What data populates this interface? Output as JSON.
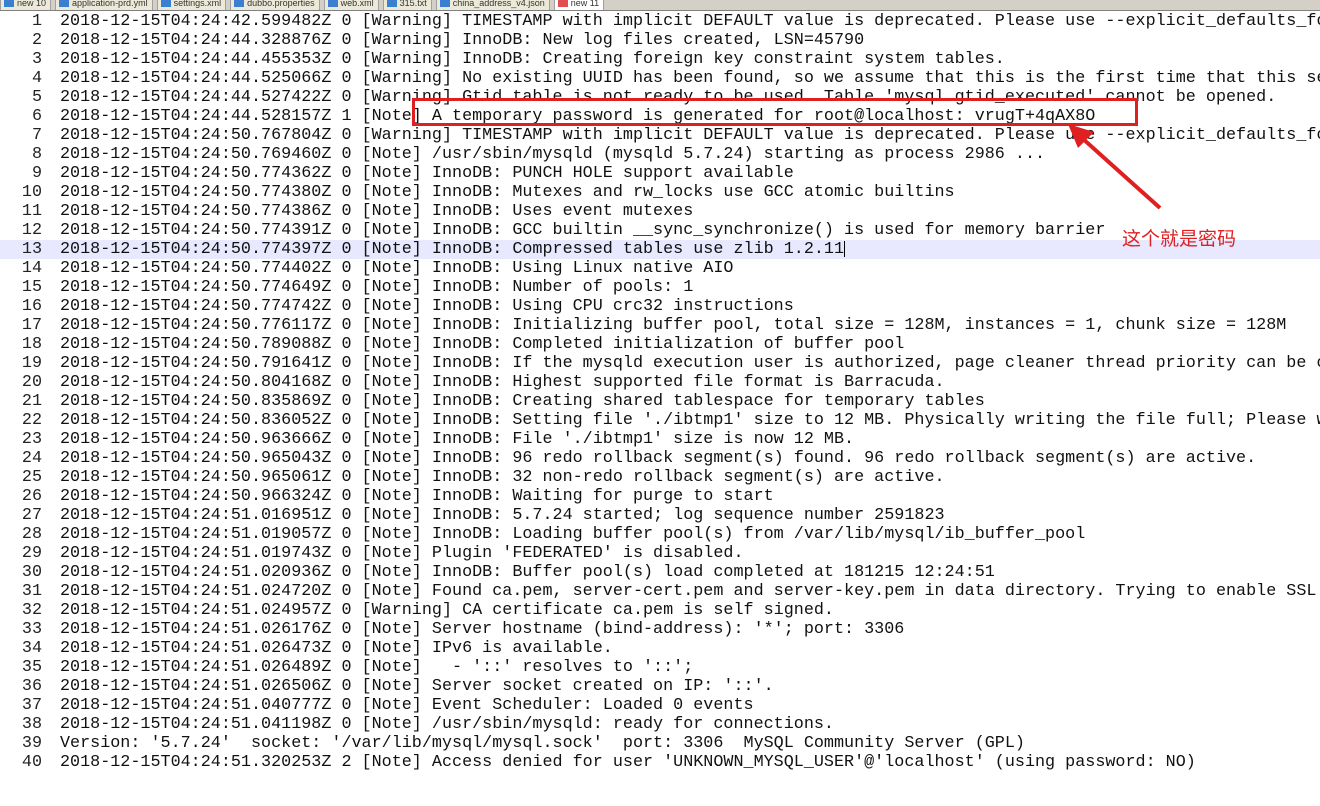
{
  "tabs": [
    {
      "label": "new 10"
    },
    {
      "label": "application-prd.yml"
    },
    {
      "label": "settings.xml"
    },
    {
      "label": "dubbo.properties"
    },
    {
      "label": "web.xml"
    },
    {
      "label": "315.txt"
    },
    {
      "label": "china_address_v4.json"
    },
    {
      "label": "new 11",
      "active": true
    }
  ],
  "editor": {
    "current_line": 13,
    "lines": [
      "2018-12-15T04:24:42.599482Z 0 [Warning] TIMESTAMP with implicit DEFAULT value is deprecated. Please use --explicit_defaults_fo",
      "2018-12-15T04:24:44.328876Z 0 [Warning] InnoDB: New log files created, LSN=45790",
      "2018-12-15T04:24:44.455353Z 0 [Warning] InnoDB: Creating foreign key constraint system tables.",
      "2018-12-15T04:24:44.525066Z 0 [Warning] No existing UUID has been found, so we assume that this is the first time that this se",
      "2018-12-15T04:24:44.527422Z 0 [Warning] Gtid table is not ready to be used. Table 'mysql.gtid_executed' cannot be opened.",
      "2018-12-15T04:24:44.528157Z 1 [Note] A temporary password is generated for root@localhost: vrugT+4qAX8O",
      "2018-12-15T04:24:50.767804Z 0 [Warning] TIMESTAMP with implicit DEFAULT value is deprecated. Please use --explicit_defaults_fo",
      "2018-12-15T04:24:50.769460Z 0 [Note] /usr/sbin/mysqld (mysqld 5.7.24) starting as process 2986 ...",
      "2018-12-15T04:24:50.774362Z 0 [Note] InnoDB: PUNCH HOLE support available",
      "2018-12-15T04:24:50.774380Z 0 [Note] InnoDB: Mutexes and rw_locks use GCC atomic builtins",
      "2018-12-15T04:24:50.774386Z 0 [Note] InnoDB: Uses event mutexes",
      "2018-12-15T04:24:50.774391Z 0 [Note] InnoDB: GCC builtin __sync_synchronize() is used for memory barrier",
      "2018-12-15T04:24:50.774397Z 0 [Note] InnoDB: Compressed tables use zlib 1.2.11",
      "2018-12-15T04:24:50.774402Z 0 [Note] InnoDB: Using Linux native AIO",
      "2018-12-15T04:24:50.774649Z 0 [Note] InnoDB: Number of pools: 1",
      "2018-12-15T04:24:50.774742Z 0 [Note] InnoDB: Using CPU crc32 instructions",
      "2018-12-15T04:24:50.776117Z 0 [Note] InnoDB: Initializing buffer pool, total size = 128M, instances = 1, chunk size = 128M",
      "2018-12-15T04:24:50.789088Z 0 [Note] InnoDB: Completed initialization of buffer pool",
      "2018-12-15T04:24:50.791641Z 0 [Note] InnoDB: If the mysqld execution user is authorized, page cleaner thread priority can be c",
      "2018-12-15T04:24:50.804168Z 0 [Note] InnoDB: Highest supported file format is Barracuda.",
      "2018-12-15T04:24:50.835869Z 0 [Note] InnoDB: Creating shared tablespace for temporary tables",
      "2018-12-15T04:24:50.836052Z 0 [Note] InnoDB: Setting file './ibtmp1' size to 12 MB. Physically writing the file full; Please w",
      "2018-12-15T04:24:50.963666Z 0 [Note] InnoDB: File './ibtmp1' size is now 12 MB.",
      "2018-12-15T04:24:50.965043Z 0 [Note] InnoDB: 96 redo rollback segment(s) found. 96 redo rollback segment(s) are active.",
      "2018-12-15T04:24:50.965061Z 0 [Note] InnoDB: 32 non-redo rollback segment(s) are active.",
      "2018-12-15T04:24:50.966324Z 0 [Note] InnoDB: Waiting for purge to start",
      "2018-12-15T04:24:51.016951Z 0 [Note] InnoDB: 5.7.24 started; log sequence number 2591823",
      "2018-12-15T04:24:51.019057Z 0 [Note] InnoDB: Loading buffer pool(s) from /var/lib/mysql/ib_buffer_pool",
      "2018-12-15T04:24:51.019743Z 0 [Note] Plugin 'FEDERATED' is disabled.",
      "2018-12-15T04:24:51.020936Z 0 [Note] InnoDB: Buffer pool(s) load completed at 181215 12:24:51",
      "2018-12-15T04:24:51.024720Z 0 [Note] Found ca.pem, server-cert.pem and server-key.pem in data directory. Trying to enable SSL",
      "2018-12-15T04:24:51.024957Z 0 [Warning] CA certificate ca.pem is self signed.",
      "2018-12-15T04:24:51.026176Z 0 [Note] Server hostname (bind-address): '*'; port: 3306",
      "2018-12-15T04:24:51.026473Z 0 [Note] IPv6 is available.",
      "2018-12-15T04:24:51.026489Z 0 [Note]   - '::' resolves to '::';",
      "2018-12-15T04:24:51.026506Z 0 [Note] Server socket created on IP: '::'.",
      "2018-12-15T04:24:51.040777Z 0 [Note] Event Scheduler: Loaded 0 events",
      "2018-12-15T04:24:51.041198Z 0 [Note] /usr/sbin/mysqld: ready for connections.",
      "Version: '5.7.24'  socket: '/var/lib/mysql/mysql.sock'  port: 3306  MySQL Community Server (GPL)",
      "2018-12-15T04:24:51.320253Z 2 [Note] Access denied for user 'UNKNOWN_MYSQL_USER'@'localhost' (using password: NO)"
    ]
  },
  "annotation": {
    "text": "这个就是密码",
    "color": "#e02020"
  }
}
